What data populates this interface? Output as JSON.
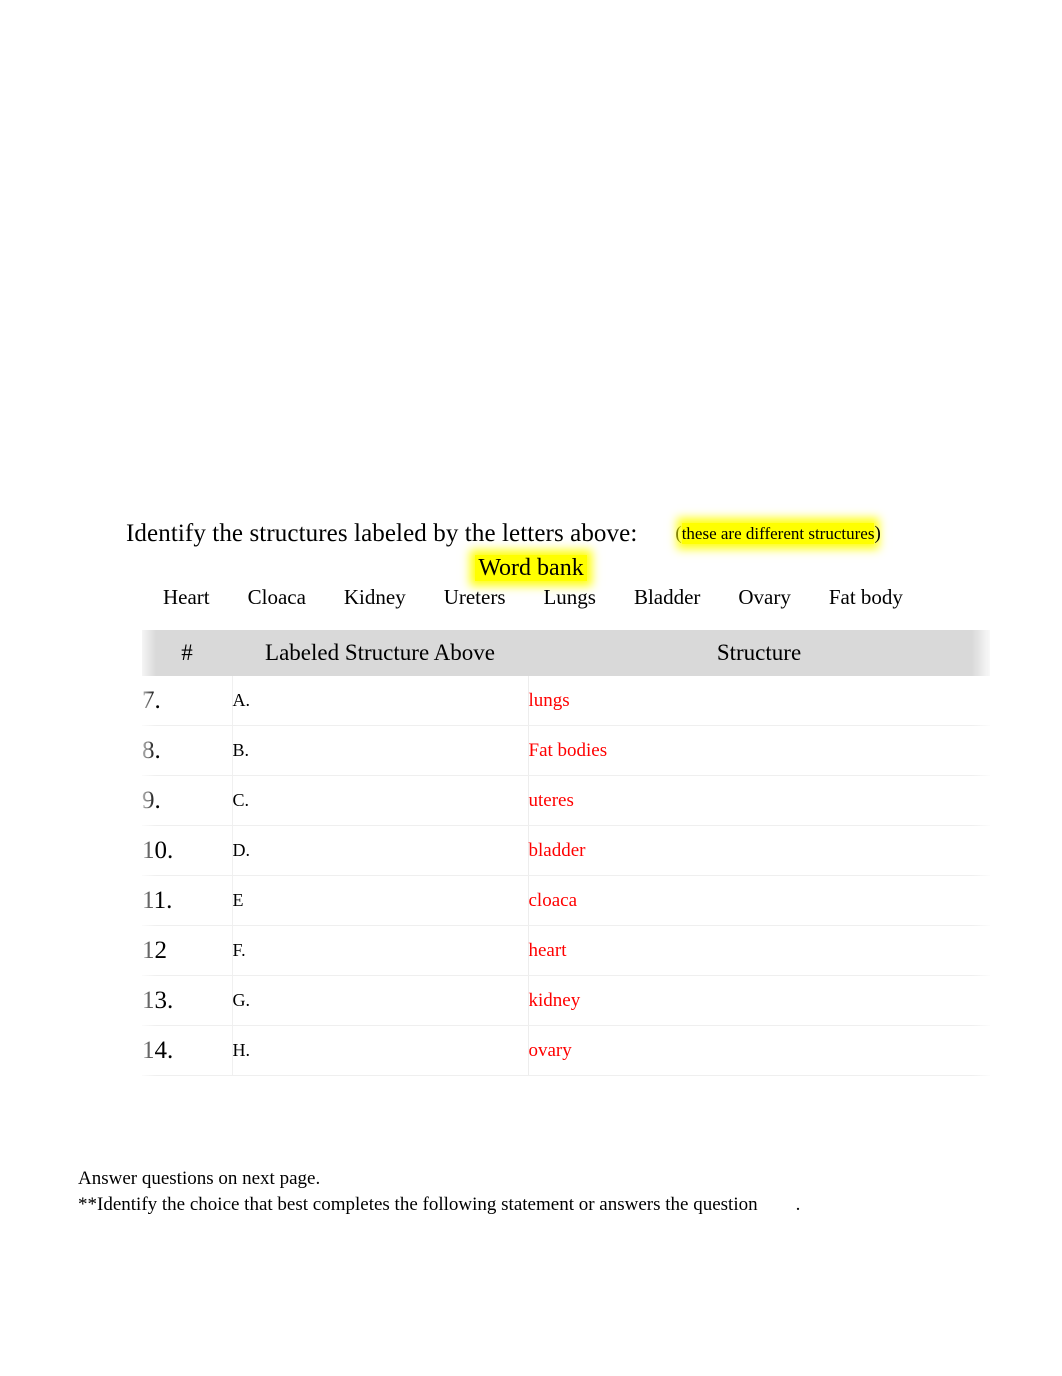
{
  "heading": {
    "prompt": "Identify the structures labeled by the letters above:",
    "note_open_paren": "(",
    "note_highlight": "these are different structures",
    "note_close_paren": ")"
  },
  "word_bank": {
    "title": "Word bank",
    "terms": [
      "Heart",
      "Cloaca",
      "Kidney",
      "Ureters",
      "Lungs",
      "Bladder",
      "Ovary",
      "Fat body"
    ]
  },
  "table": {
    "headers": {
      "number": "#",
      "labeled_structure": "Labeled Structure Above",
      "structure": "Structure"
    },
    "rows": [
      {
        "number": "7.",
        "letter": "A.",
        "structure": "lungs"
      },
      {
        "number": "8.",
        "letter": "B.",
        "structure": "Fat bodies"
      },
      {
        "number": "9.",
        "letter": "C.",
        "structure": "uteres"
      },
      {
        "number": "10.",
        "letter": "D.",
        "structure": "bladder"
      },
      {
        "number": "11.",
        "letter": "E",
        "structure": "cloaca"
      },
      {
        "number": "12",
        "letter": "F.",
        "structure": "heart"
      },
      {
        "number": "13.",
        "letter": "G.",
        "structure": "kidney"
      },
      {
        "number": "14.",
        "letter": "H.",
        "structure": "ovary"
      }
    ]
  },
  "footer": {
    "line1": "Answer questions on next page.",
    "line2": "**Identify the choice that best completes the following statement or answers the question",
    "line2_tail": "."
  },
  "colors": {
    "answer_red": "#ff0000",
    "highlight_yellow": "#ffff00",
    "header_gray": "#d9d9d9",
    "text_black": "#000000"
  }
}
